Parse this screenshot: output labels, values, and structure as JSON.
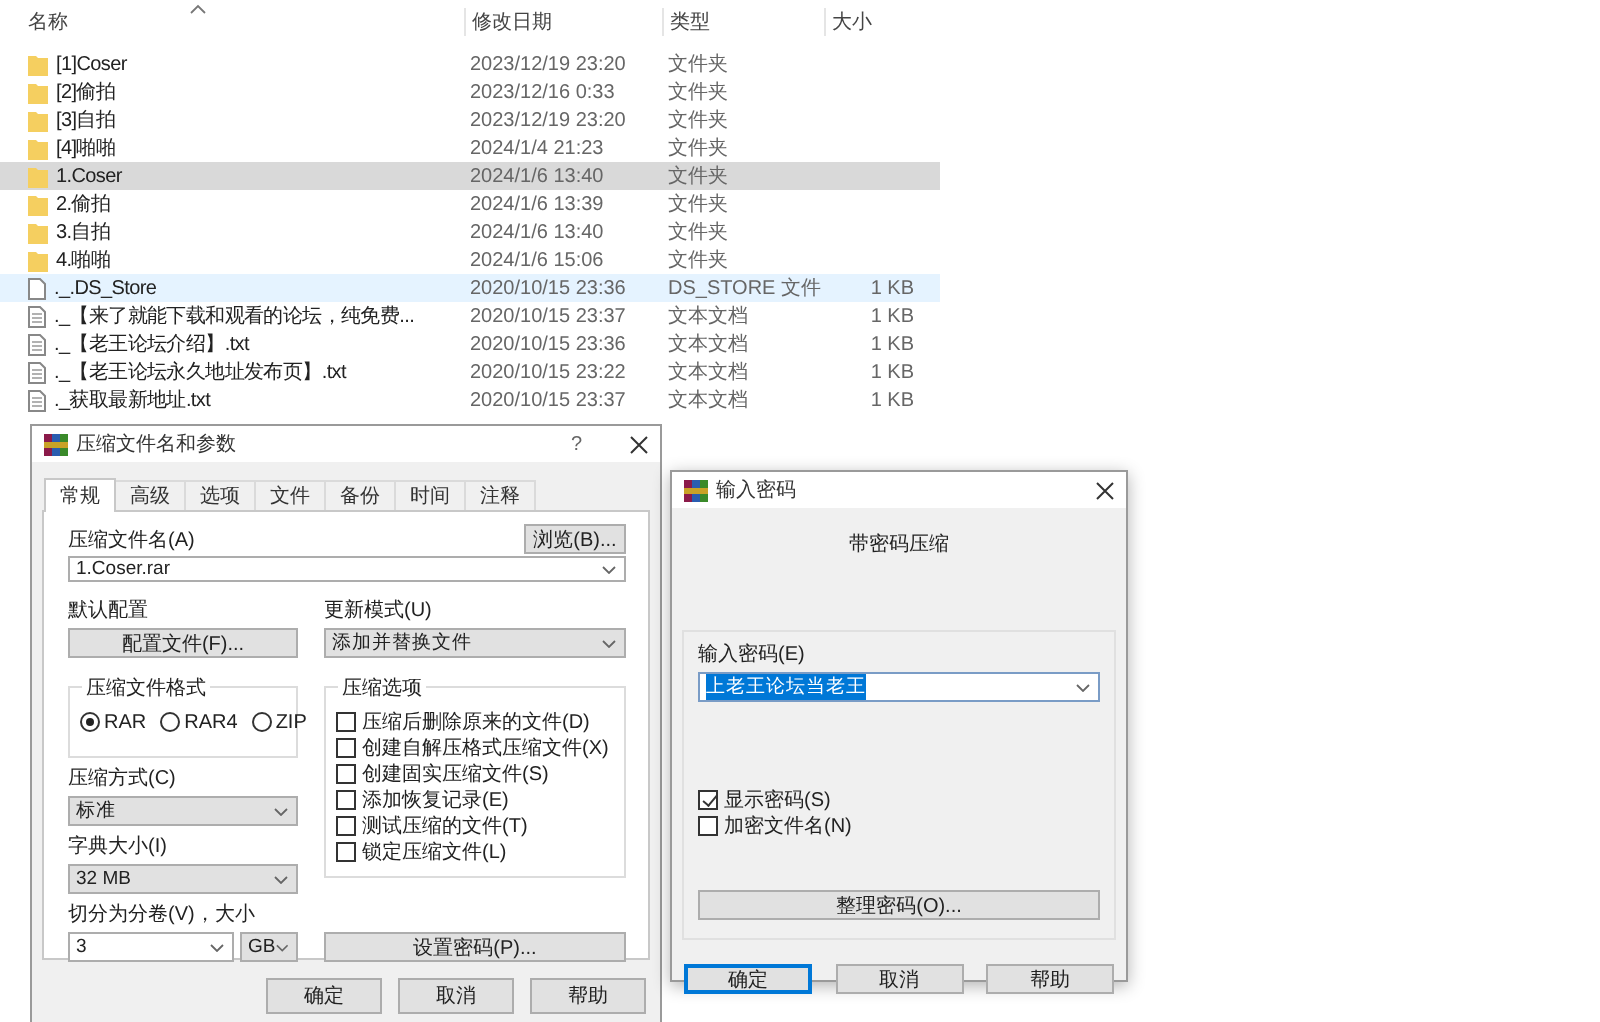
{
  "explorer": {
    "columns": [
      "名称",
      "修改日期",
      "类型",
      "大小"
    ],
    "rows": [
      {
        "kind": "folder",
        "name": "[1]Coser",
        "date": "2023/12/19 23:20",
        "type": "文件夹",
        "size": "",
        "selected": false,
        "hovered": false
      },
      {
        "kind": "folder",
        "name": "[2]偷拍",
        "date": "2023/12/16 0:33",
        "type": "文件夹",
        "size": "",
        "selected": false,
        "hovered": false
      },
      {
        "kind": "folder",
        "name": "[3]自拍",
        "date": "2023/12/19 23:20",
        "type": "文件夹",
        "size": "",
        "selected": false,
        "hovered": false
      },
      {
        "kind": "folder",
        "name": "[4]啪啪",
        "date": "2024/1/4 21:23",
        "type": "文件夹",
        "size": "",
        "selected": false,
        "hovered": false
      },
      {
        "kind": "folder",
        "name": "1.Coser",
        "date": "2024/1/6 13:40",
        "type": "文件夹",
        "size": "",
        "selected": true,
        "hovered": false
      },
      {
        "kind": "folder",
        "name": "2.偷拍",
        "date": "2024/1/6 13:39",
        "type": "文件夹",
        "size": "",
        "selected": false,
        "hovered": false
      },
      {
        "kind": "folder",
        "name": "3.自拍",
        "date": "2024/1/6 13:40",
        "type": "文件夹",
        "size": "",
        "selected": false,
        "hovered": false
      },
      {
        "kind": "folder",
        "name": "4.啪啪",
        "date": "2024/1/6 15:06",
        "type": "文件夹",
        "size": "",
        "selected": false,
        "hovered": false
      },
      {
        "kind": "file",
        "name": "._.DS_Store",
        "date": "2020/10/15 23:36",
        "type": "DS_STORE 文件",
        "size": "1 KB",
        "selected": false,
        "hovered": true
      },
      {
        "kind": "text",
        "name": "._【来了就能下载和观看的论坛，纯免费...",
        "date": "2020/10/15 23:37",
        "type": "文本文档",
        "size": "1 KB",
        "selected": false,
        "hovered": false
      },
      {
        "kind": "text",
        "name": "._【老王论坛介绍】.txt",
        "date": "2020/10/15 23:36",
        "type": "文本文档",
        "size": "1 KB",
        "selected": false,
        "hovered": false
      },
      {
        "kind": "text",
        "name": "._【老王论坛永久地址发布页】.txt",
        "date": "2020/10/15 23:22",
        "type": "文本文档",
        "size": "1 KB",
        "selected": false,
        "hovered": false
      },
      {
        "kind": "text",
        "name": "._获取最新地址.txt",
        "date": "2020/10/15 23:37",
        "type": "文本文档",
        "size": "1 KB",
        "selected": false,
        "hovered": false
      }
    ]
  },
  "compress_dialog": {
    "title": "压缩文件名和参数",
    "help_glyph": "?",
    "tabs": [
      {
        "label": "常规",
        "selected": true
      },
      {
        "label": "高级",
        "selected": false
      },
      {
        "label": "选项",
        "selected": false
      },
      {
        "label": "文件",
        "selected": false
      },
      {
        "label": "备份",
        "selected": false
      },
      {
        "label": "时间",
        "selected": false
      },
      {
        "label": "注释",
        "selected": false
      }
    ],
    "archive_name_label": "压缩文件名(A)",
    "browse_button": "浏览(B)...",
    "archive_name": "1.Coser.rar",
    "profile_label": "默认配置",
    "profile_button": "配置文件(F)...",
    "update_mode_label": "更新模式(U)",
    "update_mode": "添加并替换文件",
    "format_group": "压缩文件格式",
    "formats": [
      {
        "label": "RAR",
        "selected": true
      },
      {
        "label": "RAR4",
        "selected": false
      },
      {
        "label": "ZIP",
        "selected": false
      }
    ],
    "method_label": "压缩方式(C)",
    "method": "标准",
    "dictionary_label": "字典大小(I)",
    "dictionary": "32 MB",
    "split_label": "切分为分卷(V)，大小",
    "split_size": "3",
    "split_unit": "GB",
    "options_group": "压缩选项",
    "options": [
      {
        "label": "压缩后删除原来的文件(D)",
        "checked": false
      },
      {
        "label": "创建自解压格式压缩文件(X)",
        "checked": false
      },
      {
        "label": "创建固实压缩文件(S)",
        "checked": false
      },
      {
        "label": "添加恢复记录(E)",
        "checked": false
      },
      {
        "label": "测试压缩的文件(T)",
        "checked": false
      },
      {
        "label": "锁定压缩文件(L)",
        "checked": false
      }
    ],
    "set_password_button": "设置密码(P)...",
    "buttons": [
      {
        "label": "确定",
        "default": false
      },
      {
        "label": "取消",
        "default": false
      },
      {
        "label": "帮助",
        "default": false
      }
    ]
  },
  "password_dialog": {
    "title": "输入密码",
    "heading": "带密码压缩",
    "password_label": "输入密码(E)",
    "password": "上老王论坛当老王",
    "password_selected": true,
    "options": [
      {
        "label": "显示密码(S)",
        "checked": true
      },
      {
        "label": "加密文件名(N)",
        "checked": false
      }
    ],
    "organize_button": "整理密码(O)...",
    "buttons": [
      {
        "label": "确定",
        "default": true
      },
      {
        "label": "取消",
        "default": false
      },
      {
        "label": "帮助",
        "default": false
      }
    ]
  }
}
